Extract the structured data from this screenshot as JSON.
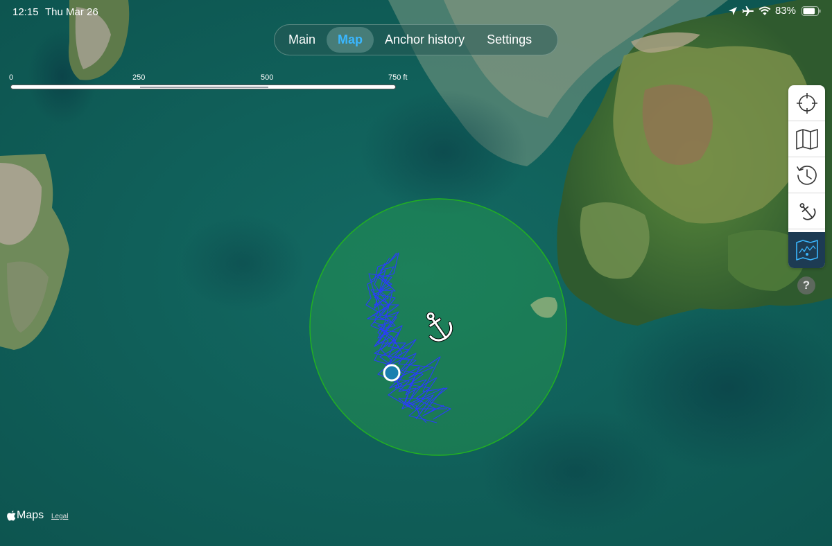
{
  "status_bar": {
    "time": "12:15",
    "date": "Thu Mar 26",
    "battery_percent": "83%",
    "battery_level": 0.83,
    "icons": [
      "location-arrow-icon",
      "airplane-icon",
      "wifi-icon",
      "battery-icon"
    ]
  },
  "tabs": [
    {
      "label": "Main",
      "active": false
    },
    {
      "label": "Map",
      "active": true
    },
    {
      "label": "Anchor history",
      "active": false
    },
    {
      "label": "Settings",
      "active": false
    }
  ],
  "scale": {
    "labels": [
      "0",
      "250",
      "500",
      "750 ft"
    ]
  },
  "toolbar": {
    "buttons": [
      {
        "icon": "crosshair-icon",
        "active": false
      },
      {
        "icon": "map-icon",
        "active": false
      },
      {
        "icon": "history-clock-icon",
        "active": false
      },
      {
        "icon": "anchor-icon",
        "active": false
      },
      {
        "icon": "track-map-icon",
        "active": true
      }
    ],
    "help_label": "?"
  },
  "attribution": {
    "maps_label": "Maps",
    "legal_label": "Legal"
  },
  "colors": {
    "accent": "#3ab7ff",
    "track": "#2b3bff",
    "swing_circle_fill": "#2ea84a",
    "swing_circle_stroke": "#22b022",
    "boat_marker": "#1a7fb0",
    "toolbar_active": "#1d3b53"
  }
}
